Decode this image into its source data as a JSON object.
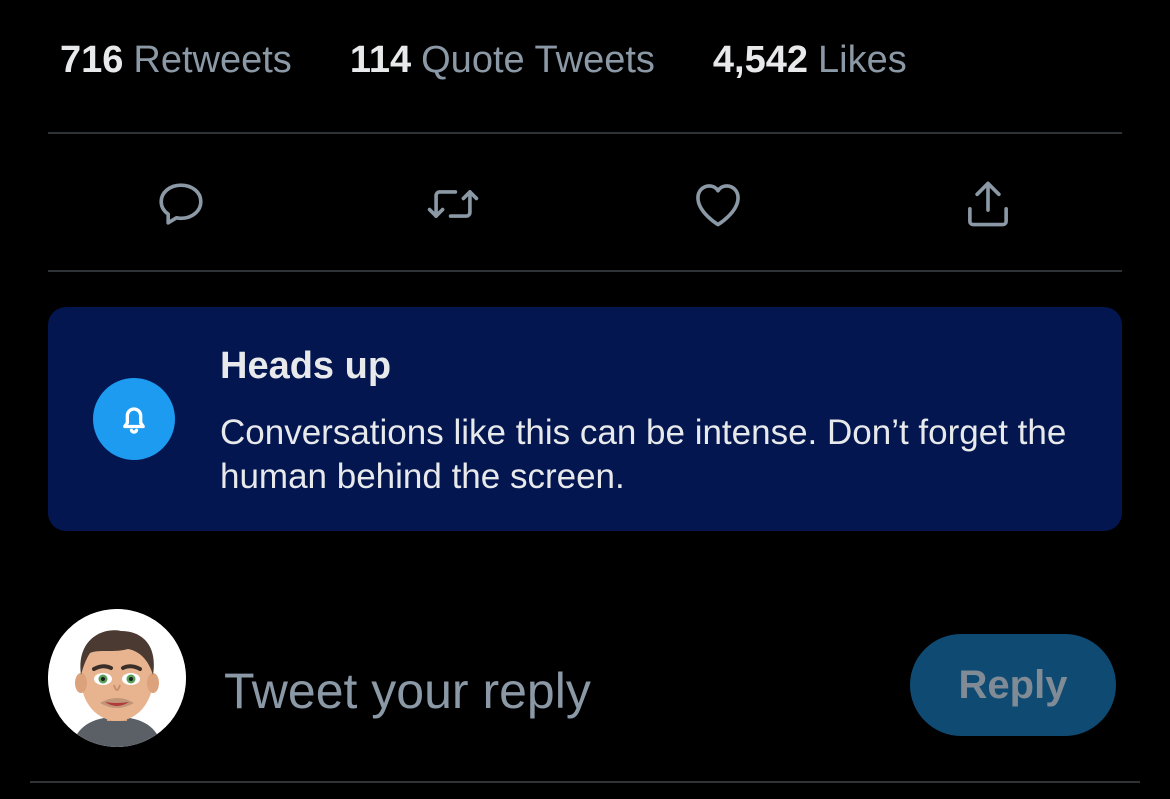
{
  "stats": {
    "retweets": {
      "count": "716",
      "label": "Retweets"
    },
    "quote_tweets": {
      "count": "114",
      "label": "Quote Tweets"
    },
    "likes": {
      "count": "4,542",
      "label": "Likes"
    }
  },
  "actions": [
    {
      "name": "reply",
      "icon": "speech-bubble-icon"
    },
    {
      "name": "retweet",
      "icon": "retweet-arrows-icon"
    },
    {
      "name": "like",
      "icon": "heart-icon"
    },
    {
      "name": "share",
      "icon": "share-upload-icon"
    }
  ],
  "notice": {
    "icon": "bell-icon",
    "title": "Heads up",
    "body": "Conversations like this can be intense. Don’t forget the human behind the screen."
  },
  "reply": {
    "placeholder": "Tweet your reply",
    "button_label": "Reply"
  },
  "colors": {
    "background": "#000000",
    "text_primary": "#e7e9ea",
    "text_secondary": "#8b98a5",
    "divider": "#2f3336",
    "notice_background": "#031650",
    "accent_blue": "#1d9bf0",
    "reply_button_disabled": "#0e4a72"
  }
}
